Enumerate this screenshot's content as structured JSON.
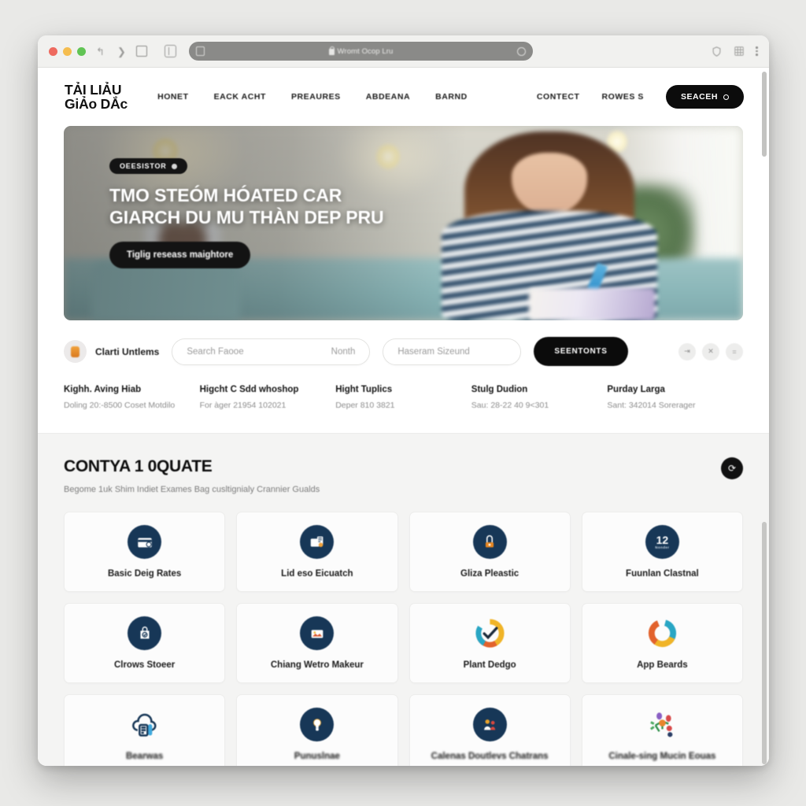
{
  "browser": {
    "traffic_lights": [
      "close",
      "minimize",
      "maximize"
    ],
    "back_icon": "back-arrow-icon",
    "forward_icon": "forward-chevron-icon",
    "tab_icon": "tab-square-icon",
    "sidebar_icon": "sidebar-panel-icon",
    "url": "Wromt Ocop Lru",
    "url_lock_icon": "lock-icon",
    "reload_icon": "reload-icon",
    "shield_icon": "shield-icon",
    "extensions_icon": "grid-extensions-icon",
    "menu_icon": "kebab-menu-icon"
  },
  "header": {
    "logo_line1": "TẢI LIẢU",
    "logo_line2": "GiẢo DẮc",
    "nav": [
      {
        "label": "HONET"
      },
      {
        "label": "EACK ACHT"
      },
      {
        "label": "PREAURES"
      },
      {
        "label": "ABDEANA"
      },
      {
        "label": "BARND"
      }
    ],
    "right_links": [
      {
        "label": "CONTECT"
      },
      {
        "label": "ROWES S"
      }
    ],
    "search_button": "SEACEH",
    "search_icon": "magnifier-icon"
  },
  "hero": {
    "badge": "OEESISTOR",
    "badge_icon": "dot-icon",
    "title_line1": "TMO STEÓM HÓATED CAR",
    "title_line2": "GIARCH DU MU THÀN DEP PRU",
    "cta": "Tiglig reseass maightore"
  },
  "filter_bar": {
    "brand_label": "Clarti Untlems",
    "brand_icon": "bookmark-avatar-icon",
    "search_placeholder": "Search Faooe",
    "search_secondary": "Nonth",
    "region_placeholder": "Haseram Sizeund",
    "submit_label": "SEENTONTS",
    "icon_chips": [
      {
        "name": "filter-icon",
        "glyph": "⇥"
      },
      {
        "name": "shuffle-icon",
        "glyph": "✕"
      },
      {
        "name": "list-icon",
        "glyph": "="
      }
    ]
  },
  "stats": [
    {
      "title": "Kighh. Aving Hiab",
      "sub": "Doling 20:-8500 Coset Motdilo"
    },
    {
      "title": "Higcht C Sdd whoshop",
      "sub": "For àger 21954 102021"
    },
    {
      "title": "Hight Tuplics",
      "sub": "Deper 810 3821"
    },
    {
      "title": "Stulg Dudion",
      "sub": "Sau: 28-22 40 9<301"
    },
    {
      "title": "Purday Larga",
      "sub": "Sant: 342014 Sorerager"
    }
  ],
  "section": {
    "title": "CONTYA 1 0QUATE",
    "subtitle": "Begome 1uk Shim Indiet Exames Bag cusltignialy Crannier Gualds",
    "action_icon": "refresh-icon"
  },
  "cards": [
    {
      "label": "Basic Deig Rates",
      "icon": "credit-card-icon",
      "style": "navy"
    },
    {
      "label": "Lid eso Eicuatch",
      "icon": "document-certificate-icon",
      "style": "navy"
    },
    {
      "label": "Gliza Pleastic",
      "icon": "lock-shield-icon",
      "style": "navy"
    },
    {
      "label": "Fuunlan Clastnal",
      "icon": "number-badge-icon",
      "style": "navy",
      "badge_number": "12"
    },
    {
      "label": "Clrows Stoeer",
      "icon": "shopping-bag-icon",
      "style": "navy"
    },
    {
      "label": "Chiang Wetro Makeur",
      "icon": "image-photo-icon",
      "style": "navy"
    },
    {
      "label": "Plant Dedgo",
      "icon": "donut-check-icon",
      "style": "color"
    },
    {
      "label": "App Beards",
      "icon": "donut-ring-icon",
      "style": "color"
    },
    {
      "label": "Bearwas",
      "icon": "cloud-document-icon",
      "style": "outline"
    },
    {
      "label": "Punuslnae",
      "icon": "lightbulb-idea-icon",
      "style": "navy"
    },
    {
      "label": "Calenas Doutlevs Chatrans",
      "icon": "people-group-icon",
      "style": "navy"
    },
    {
      "label": "Cinale-sing Mucin Eouas",
      "icon": "molecule-network-icon",
      "style": "color"
    }
  ]
}
